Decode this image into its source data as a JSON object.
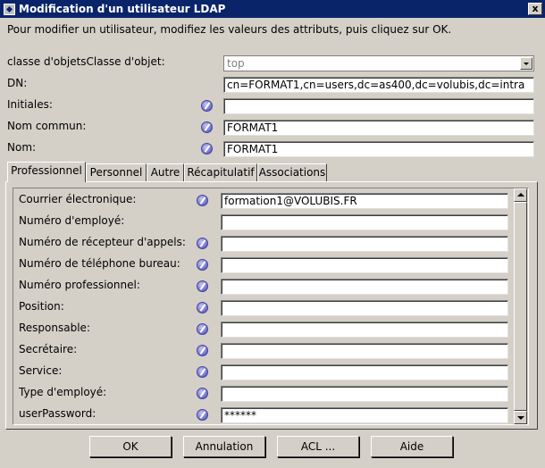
{
  "window": {
    "title": "Modification d'un utilisateur LDAP",
    "close_glyph": "x"
  },
  "instructions": "Pour modifier un utilisateur, modifiez les valeurs des attributs, puis cliquez sur OK.",
  "top_fields": {
    "object_class_label": "classe d'objetsClasse d'objet:",
    "object_class_value": "top",
    "dn_label": "DN:",
    "dn_value": "cn=FORMAT1,cn=users,dc=as400,dc=volubis,dc=intra",
    "initials_label": "Initiales:",
    "initials_value": "",
    "common_name_label": "Nom commun:",
    "common_name_value": "FORMAT1",
    "name_label": "Nom:",
    "name_value": "FORMAT1"
  },
  "tabs": [
    {
      "label": "Professionnel",
      "active": true
    },
    {
      "label": "Personnel",
      "active": false
    },
    {
      "label": "Autre",
      "active": false
    },
    {
      "label": "Récapitulatif",
      "active": false
    },
    {
      "label": "Associations",
      "active": false
    }
  ],
  "professional_fields": [
    {
      "label": "Courrier électronique:",
      "value": "formation1@VOLUBIS.FR",
      "editable_icon": true
    },
    {
      "label": "Numéro d'employé:",
      "value": "",
      "editable_icon": false
    },
    {
      "label": "Numéro de récepteur d'appels:",
      "value": "",
      "editable_icon": true
    },
    {
      "label": "Numéro de téléphone bureau:",
      "value": "",
      "editable_icon": true
    },
    {
      "label": "Numéro professionnel:",
      "value": "",
      "editable_icon": true
    },
    {
      "label": "Position:",
      "value": "",
      "editable_icon": true
    },
    {
      "label": "Responsable:",
      "value": "",
      "editable_icon": true
    },
    {
      "label": "Secrétaire:",
      "value": "",
      "editable_icon": true
    },
    {
      "label": "Service:",
      "value": "",
      "editable_icon": true
    },
    {
      "label": "Type d'employé:",
      "value": "",
      "editable_icon": true
    },
    {
      "label": "userPassword:",
      "value": "******",
      "editable_icon": true
    }
  ],
  "buttons": {
    "ok": "OK",
    "cancel": "Annulation",
    "acl": "ACL ...",
    "help": "Aide"
  },
  "colors": {
    "titlebar": "#0a246a",
    "window_bg": "#d4d0c8"
  }
}
